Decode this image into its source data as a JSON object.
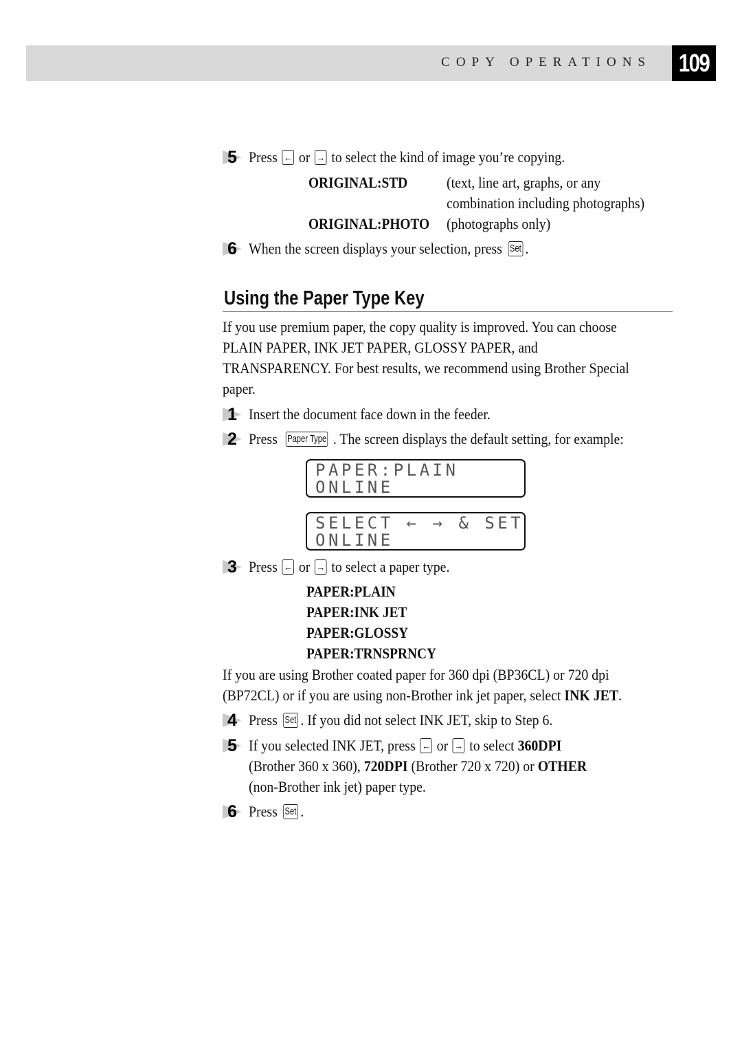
{
  "header": {
    "section_title": "COPY OPERATIONS",
    "page_number": "109",
    "band_color": "#d9d9d9"
  },
  "top_steps": [
    {
      "number": "5",
      "pre": "Press",
      "key_left": "←",
      "mid": "or",
      "key_right": "→",
      "post": "to select the kind of image you’re copying."
    },
    {
      "number": "6",
      "pre": "When the screen displays your selection, press",
      "key": "Set",
      "post": "."
    }
  ],
  "original_options": [
    {
      "label": "ORIGINAL:STD",
      "desc_lines": [
        "(text, line art, graphs, or any",
        "combination including photographs)"
      ]
    },
    {
      "label": "ORIGINAL:PHOTO",
      "desc_lines": [
        "(photographs only)"
      ]
    }
  ],
  "section": {
    "title": "Using the Paper Type Key",
    "intro_lines": [
      "If you use premium paper, the copy quality is improved. You can choose",
      "PLAIN PAPER, INK JET PAPER, GLOSSY PAPER, and",
      "TRANSPARENCY. For best results, we recommend using Brother Special",
      "paper."
    ]
  },
  "steps": [
    {
      "number": "1",
      "text": "Insert the document face down in the feeder."
    },
    {
      "number": "2",
      "pre": "Press",
      "key": "Paper Type",
      "post": ". The screen displays the default setting, for example:"
    },
    {
      "number": "3",
      "pre": "Press",
      "key_left": "←",
      "mid": "or",
      "key_right": "→",
      "post": "to select a paper type."
    },
    {
      "number": "4",
      "pre": "Press",
      "key": "Set",
      "post": ". If you did not select INK JET, skip to Step 6."
    },
    {
      "number": "5",
      "pre": "If you selected INK JET, press",
      "key_left": "←",
      "mid": "or",
      "key_right": "→",
      "post": "to select",
      "bold1": "360DPI",
      "line2_pre": "(Brother 360 x 360),",
      "bold2": "720DPI",
      "line2_mid": "(Brother 720 x 720) or",
      "bold3": "OTHER",
      "line3": "(non-Brother ink jet) paper type."
    },
    {
      "number": "6",
      "pre": "Press",
      "key": "Set",
      "post": "."
    }
  ],
  "lcd_displays": [
    {
      "line1": "PAPER:PLAIN",
      "line2": "ONLINE"
    },
    {
      "line1": "SELECT ← → & SET",
      "line2": "ONLINE"
    }
  ],
  "paper_options": [
    "PAPER:PLAIN",
    "PAPER:INK JET",
    "PAPER:GLOSSY",
    "PAPER:TRNSPRNCY"
  ],
  "note": {
    "line1": "If you are using Brother coated paper for 360 dpi (BP36CL) or 720 dpi",
    "line2_pre": "(BP72CL) or if you are using non-Brother ink jet paper, select",
    "line2_bold": "INK JET",
    "line2_post": "."
  }
}
